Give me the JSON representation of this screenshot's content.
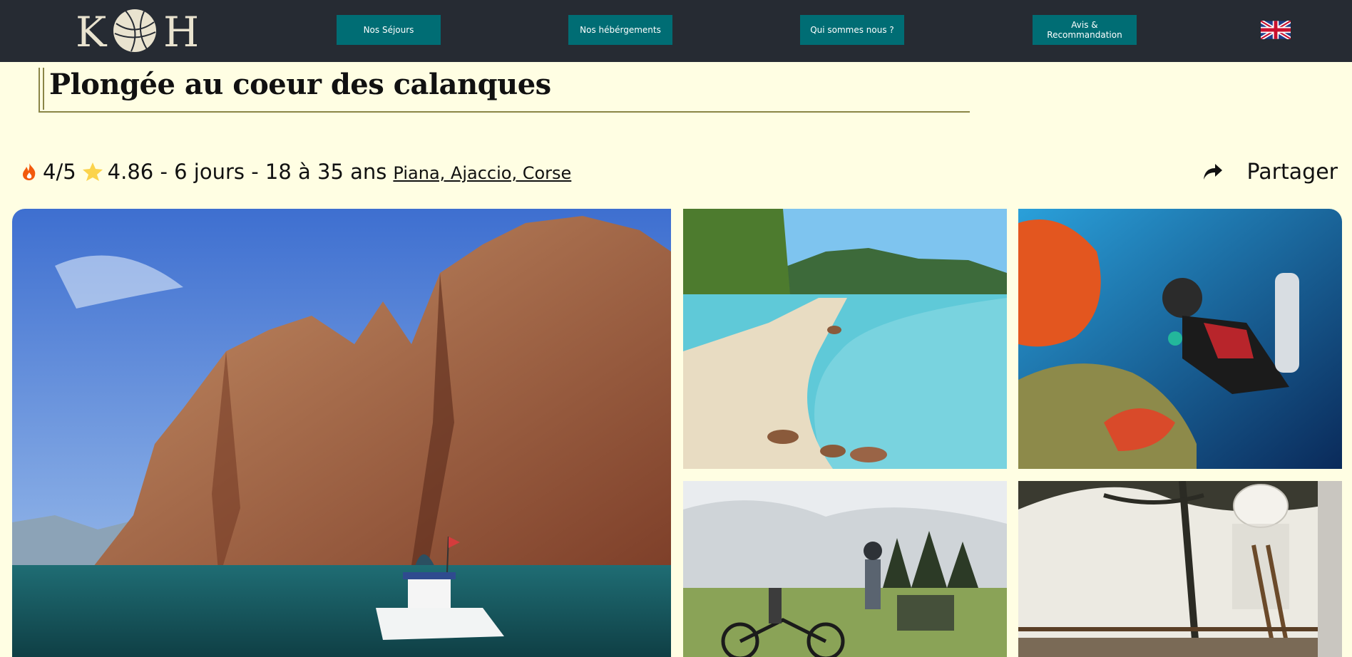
{
  "header": {
    "logo_text": "KOH",
    "nav": [
      {
        "label": "Nos Séjours"
      },
      {
        "label": "Nos hébérgements"
      },
      {
        "label": "Qui sommes nous ?"
      },
      {
        "label_line1": "Avis &",
        "label_line2": "Recommandation"
      }
    ],
    "language_flag": "uk-flag-icon"
  },
  "page": {
    "title": "Plongée au coeur des calanques",
    "difficulty": "4/5",
    "rating_and_info": "4.86 - 6 jours - 18 à 35 ans",
    "location": "Piana, Ajaccio, Corse",
    "share_label": "Partager"
  },
  "icons": {
    "difficulty": "fire-icon",
    "rating": "star-icon",
    "share": "share-arrow-icon"
  },
  "gallery": [
    {
      "subject": "red rock cliffs and boat on turquoise sea"
    },
    {
      "subject": "sandy beach with turquoise water"
    },
    {
      "subject": "scuba diver with red coral"
    },
    {
      "subject": "group with mountain bikes near pine trees"
    },
    {
      "subject": "tree house with paper lantern"
    }
  ],
  "colors": {
    "header_bg": "#262b33",
    "nav_button_bg": "#006d74",
    "page_bg": "#fffee3",
    "title_border": "#8a8547"
  }
}
